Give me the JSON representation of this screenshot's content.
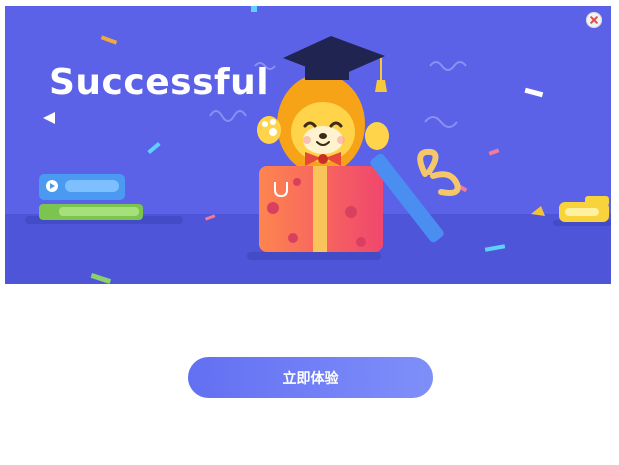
{
  "dialog": {
    "headline": "Successful",
    "cta_label": "立即体验",
    "colors": {
      "banner": "#5b62e8",
      "button_start": "#6270f2",
      "button_end": "#7f8ff9",
      "close_x": "#e24b4b"
    },
    "icons": {
      "close": "close-icon",
      "illustration": "lion-gift-box-illustration",
      "play": "play-icon"
    }
  }
}
